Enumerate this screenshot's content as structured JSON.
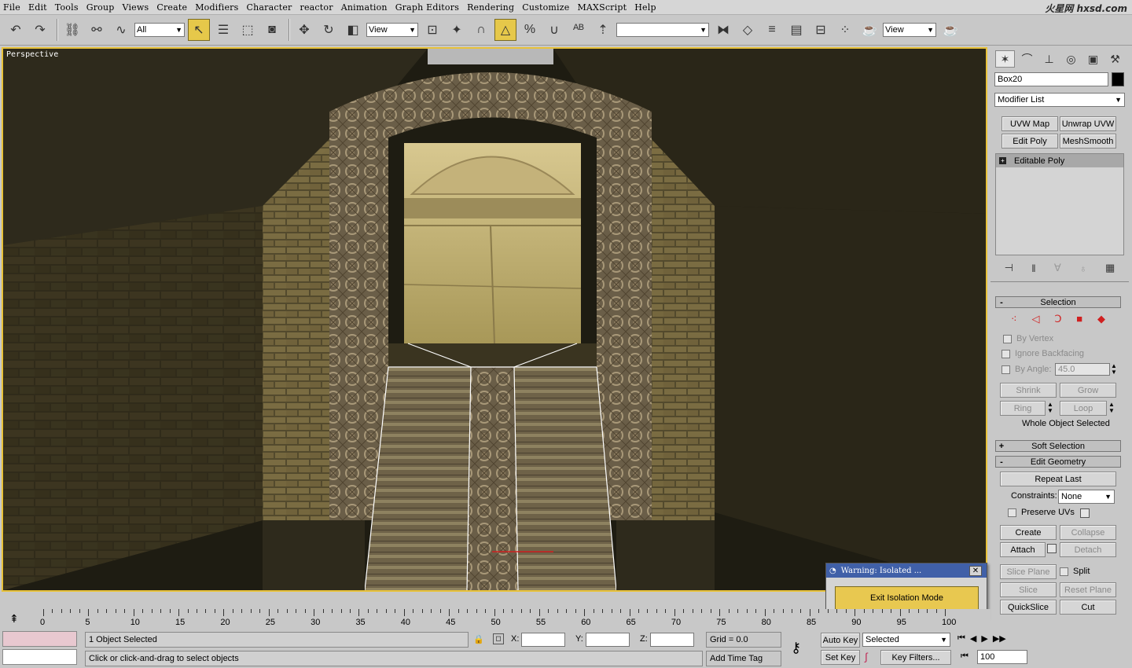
{
  "menu": [
    "File",
    "Edit",
    "Tools",
    "Group",
    "Views",
    "Create",
    "Modifiers",
    "Character",
    "reactor",
    "Animation",
    "Graph Editors",
    "Rendering",
    "Customize",
    "MAXScript",
    "Help"
  ],
  "brand": "火星网 hxsd.com",
  "toolbar": {
    "selection_filter": "All",
    "ref_coord": "View",
    "named_selection": "",
    "render_view": "View"
  },
  "viewport": {
    "label": "Perspective"
  },
  "command_panel": {
    "object_name": "Box20",
    "object_color": "#000000",
    "modifier_list": "Modifier List",
    "quick_buttons": [
      "UVW Map",
      "Unwrap UVW",
      "Edit Poly",
      "MeshSmooth"
    ],
    "stack_item": "Editable Poly",
    "selection": {
      "title": "Selection",
      "by_vertex": "By Vertex",
      "ignore_backfacing": "Ignore Backfacing",
      "by_angle": "By Angle:",
      "angle_value": "45.0",
      "shrink": "Shrink",
      "grow": "Grow",
      "ring": "Ring",
      "loop": "Loop",
      "status": "Whole Object Selected"
    },
    "soft_selection": "Soft Selection",
    "edit_geometry": {
      "title": "Edit Geometry",
      "repeat_last": "Repeat Last",
      "constraints_label": "Constraints:",
      "constraints_value": "None",
      "preserve_uvs": "Preserve UVs",
      "create": "Create",
      "collapse": "Collapse",
      "attach": "Attach",
      "detach": "Detach",
      "slice_plane": "Slice Plane",
      "split": "Split",
      "slice": "Slice",
      "reset_plane": "Reset Plane",
      "quickslice": "QuickSlice",
      "cut": "Cut"
    }
  },
  "timeline": {
    "ticks": [
      "0",
      "5",
      "10",
      "15",
      "20",
      "25",
      "30",
      "35",
      "40",
      "45",
      "50",
      "55",
      "60",
      "65",
      "70",
      "75",
      "80",
      "85",
      "90",
      "95",
      "100"
    ]
  },
  "status": {
    "selection_info": "1 Object Selected",
    "prompt": "Click or click-and-drag to select objects",
    "x_label": "X:",
    "y_label": "Y:",
    "z_label": "Z:",
    "grid": "Grid = 0.0",
    "add_time_tag": "Add Time Tag",
    "auto_key": "Auto Key",
    "set_key": "Set Key",
    "key_mode": "Selected",
    "key_filters": "Key Filters...",
    "frame": "100"
  },
  "popup": {
    "title": "Warning: Isolated ...",
    "button": "Exit Isolation Mode"
  }
}
